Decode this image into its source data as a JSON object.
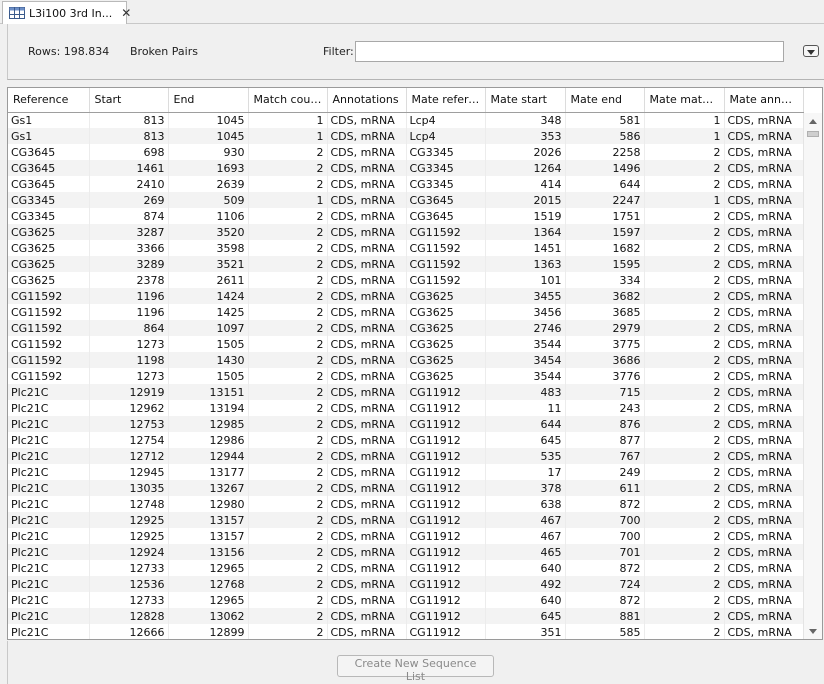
{
  "tab": {
    "title": "L3i100 3rd In...",
    "icon": "table-icon",
    "close": "✕"
  },
  "header": {
    "rows_label": "Rows: 198.834",
    "mode_label": "Broken Pairs",
    "filter_label": "Filter:",
    "filter_value": ""
  },
  "table": {
    "columns": [
      "Reference",
      "Start",
      "End",
      "Match count",
      "Annotations",
      "Mate refere...",
      "Mate start",
      "Mate end",
      "Mate match...",
      "Mate annot..."
    ],
    "rows": [
      [
        "Gs1",
        "813",
        "1045",
        "1",
        "CDS, mRNA",
        "Lcp4",
        "348",
        "581",
        "1",
        "CDS, mRNA"
      ],
      [
        "Gs1",
        "813",
        "1045",
        "1",
        "CDS, mRNA",
        "Lcp4",
        "353",
        "586",
        "1",
        "CDS, mRNA"
      ],
      [
        "CG3645",
        "698",
        "930",
        "2",
        "CDS, mRNA",
        "CG3345",
        "2026",
        "2258",
        "2",
        "CDS, mRNA"
      ],
      [
        "CG3645",
        "1461",
        "1693",
        "2",
        "CDS, mRNA",
        "CG3345",
        "1264",
        "1496",
        "2",
        "CDS, mRNA"
      ],
      [
        "CG3645",
        "2410",
        "2639",
        "2",
        "CDS, mRNA",
        "CG3345",
        "414",
        "644",
        "2",
        "CDS, mRNA"
      ],
      [
        "CG3345",
        "269",
        "509",
        "1",
        "CDS, mRNA",
        "CG3645",
        "2015",
        "2247",
        "1",
        "CDS, mRNA"
      ],
      [
        "CG3345",
        "874",
        "1106",
        "2",
        "CDS, mRNA",
        "CG3645",
        "1519",
        "1751",
        "2",
        "CDS, mRNA"
      ],
      [
        "CG3625",
        "3287",
        "3520",
        "2",
        "CDS, mRNA",
        "CG11592",
        "1364",
        "1597",
        "2",
        "CDS, mRNA"
      ],
      [
        "CG3625",
        "3366",
        "3598",
        "2",
        "CDS, mRNA",
        "CG11592",
        "1451",
        "1682",
        "2",
        "CDS, mRNA"
      ],
      [
        "CG3625",
        "3289",
        "3521",
        "2",
        "CDS, mRNA",
        "CG11592",
        "1363",
        "1595",
        "2",
        "CDS, mRNA"
      ],
      [
        "CG3625",
        "2378",
        "2611",
        "2",
        "CDS, mRNA",
        "CG11592",
        "101",
        "334",
        "2",
        "CDS, mRNA"
      ],
      [
        "CG11592",
        "1196",
        "1424",
        "2",
        "CDS, mRNA",
        "CG3625",
        "3455",
        "3682",
        "2",
        "CDS, mRNA"
      ],
      [
        "CG11592",
        "1196",
        "1425",
        "2",
        "CDS, mRNA",
        "CG3625",
        "3456",
        "3685",
        "2",
        "CDS, mRNA"
      ],
      [
        "CG11592",
        "864",
        "1097",
        "2",
        "CDS, mRNA",
        "CG3625",
        "2746",
        "2979",
        "2",
        "CDS, mRNA"
      ],
      [
        "CG11592",
        "1273",
        "1505",
        "2",
        "CDS, mRNA",
        "CG3625",
        "3544",
        "3775",
        "2",
        "CDS, mRNA"
      ],
      [
        "CG11592",
        "1198",
        "1430",
        "2",
        "CDS, mRNA",
        "CG3625",
        "3454",
        "3686",
        "2",
        "CDS, mRNA"
      ],
      [
        "CG11592",
        "1273",
        "1505",
        "2",
        "CDS, mRNA",
        "CG3625",
        "3544",
        "3776",
        "2",
        "CDS, mRNA"
      ],
      [
        "Plc21C",
        "12919",
        "13151",
        "2",
        "CDS, mRNA",
        "CG11912",
        "483",
        "715",
        "2",
        "CDS, mRNA"
      ],
      [
        "Plc21C",
        "12962",
        "13194",
        "2",
        "CDS, mRNA",
        "CG11912",
        "11",
        "243",
        "2",
        "CDS, mRNA"
      ],
      [
        "Plc21C",
        "12753",
        "12985",
        "2",
        "CDS, mRNA",
        "CG11912",
        "644",
        "876",
        "2",
        "CDS, mRNA"
      ],
      [
        "Plc21C",
        "12754",
        "12986",
        "2",
        "CDS, mRNA",
        "CG11912",
        "645",
        "877",
        "2",
        "CDS, mRNA"
      ],
      [
        "Plc21C",
        "12712",
        "12944",
        "2",
        "CDS, mRNA",
        "CG11912",
        "535",
        "767",
        "2",
        "CDS, mRNA"
      ],
      [
        "Plc21C",
        "12945",
        "13177",
        "2",
        "CDS, mRNA",
        "CG11912",
        "17",
        "249",
        "2",
        "CDS, mRNA"
      ],
      [
        "Plc21C",
        "13035",
        "13267",
        "2",
        "CDS, mRNA",
        "CG11912",
        "378",
        "611",
        "2",
        "CDS, mRNA"
      ],
      [
        "Plc21C",
        "12748",
        "12980",
        "2",
        "CDS, mRNA",
        "CG11912",
        "638",
        "872",
        "2",
        "CDS, mRNA"
      ],
      [
        "Plc21C",
        "12925",
        "13157",
        "2",
        "CDS, mRNA",
        "CG11912",
        "467",
        "700",
        "2",
        "CDS, mRNA"
      ],
      [
        "Plc21C",
        "12925",
        "13157",
        "2",
        "CDS, mRNA",
        "CG11912",
        "467",
        "700",
        "2",
        "CDS, mRNA"
      ],
      [
        "Plc21C",
        "12924",
        "13156",
        "2",
        "CDS, mRNA",
        "CG11912",
        "465",
        "701",
        "2",
        "CDS, mRNA"
      ],
      [
        "Plc21C",
        "12733",
        "12965",
        "2",
        "CDS, mRNA",
        "CG11912",
        "640",
        "872",
        "2",
        "CDS, mRNA"
      ],
      [
        "Plc21C",
        "12536",
        "12768",
        "2",
        "CDS, mRNA",
        "CG11912",
        "492",
        "724",
        "2",
        "CDS, mRNA"
      ],
      [
        "Plc21C",
        "12733",
        "12965",
        "2",
        "CDS, mRNA",
        "CG11912",
        "640",
        "872",
        "2",
        "CDS, mRNA"
      ],
      [
        "Plc21C",
        "12828",
        "13062",
        "2",
        "CDS, mRNA",
        "CG11912",
        "645",
        "881",
        "2",
        "CDS, mRNA"
      ],
      [
        "Plc21C",
        "12666",
        "12899",
        "2",
        "CDS, mRNA",
        "CG11912",
        "351",
        "585",
        "2",
        "CDS, mRNA"
      ]
    ]
  },
  "footer": {
    "create_button": "Create New Sequence List"
  }
}
